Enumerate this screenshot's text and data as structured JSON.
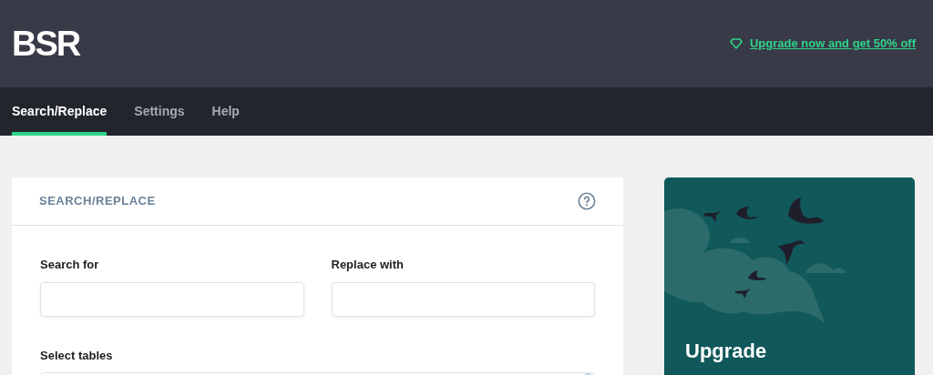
{
  "header": {
    "logo": "BSR",
    "upgrade_link": "Upgrade now and get 50% off"
  },
  "tabs": [
    {
      "label": "Search/Replace",
      "selected": true
    },
    {
      "label": "Settings",
      "selected": false
    },
    {
      "label": "Help",
      "selected": false
    }
  ],
  "panel": {
    "title": "SEARCH/REPLACE",
    "fields": [
      {
        "label": "Search for"
      },
      {
        "label": "Replace with"
      }
    ],
    "select_tables": {
      "label": "Select tables"
    }
  },
  "upgrade_card": {
    "title": "Upgrade"
  }
}
